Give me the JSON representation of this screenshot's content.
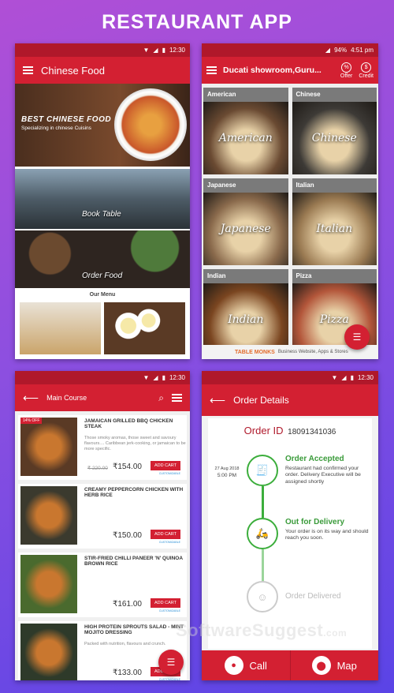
{
  "header": {
    "title": "RESTAURANT APP"
  },
  "phone1": {
    "time": "12:30",
    "title": "Chinese Food",
    "banner_title": "BEST CHINESE FOOD",
    "banner_subtitle": "Specializing in chinese Cuisins",
    "book_label": "Book Table",
    "order_label": "Order Food",
    "menu_heading": "Our Menu"
  },
  "phone2": {
    "battery": "94%",
    "time": "4:51 pm",
    "title": "Ducati showroom,Guru...",
    "offer_label": "Offer",
    "credit_label": "Credit",
    "cuisines": [
      {
        "name": "American",
        "script": "American",
        "color": "#6a4a32"
      },
      {
        "name": "Chinese",
        "script": "Chinese",
        "color": "#3d3a36"
      },
      {
        "name": "Japanese",
        "script": "Japanese",
        "color": "#8a6a4c"
      },
      {
        "name": "Italian",
        "script": "Italian",
        "color": "#9a7a52"
      },
      {
        "name": "Indian",
        "script": "Indian",
        "color": "#7a4520"
      },
      {
        "name": "Pizza",
        "script": "Pizza",
        "color": "#b3563a"
      }
    ],
    "brand": "TABLE MONKS",
    "brand_tag": "Business Website, Apps & Stores"
  },
  "phone3": {
    "time": "12:30",
    "title": "Main Course",
    "add_label": "ADD CART",
    "custom_label": "CUSTOMIZABLE",
    "dishes": [
      {
        "name": "JAMAICAN GRILLED BBQ CHICKEN STEAK",
        "desc": "Those smoky aromas, those sweet and savoury flavours.... Caribbean jerk-cooking, or jamaican to be more specific.",
        "old_price": "₹ 220.00",
        "price": "₹154.00",
        "badge": "14% OFF"
      },
      {
        "name": "CREAMY PEPPERCORN CHICKEN WITH HERB RICE",
        "desc": "",
        "old_price": "",
        "price": "₹150.00",
        "badge": ""
      },
      {
        "name": "STIR-FRIED CHILLI PANEER 'N' QUINOA BROWN RICE",
        "desc": "",
        "old_price": "",
        "price": "₹161.00",
        "badge": ""
      },
      {
        "name": "HIGH PROTEIN SPROUTS SALAD - MINT MOJITO DRESSING",
        "desc": "Packed with nutrition, flavours and crunch.",
        "old_price": "",
        "price": "₹133.00",
        "badge": ""
      }
    ]
  },
  "phone4": {
    "time": "12:30",
    "title": "Order Details",
    "order_label": "Order ID",
    "order_id": "18091341036",
    "date": "27 Aug 2018",
    "clock": "5:00 PM",
    "stages": [
      {
        "title": "Order Accepted",
        "desc": "Restaurant had confirmed your order. Delivery Executive will be assigned shortly"
      },
      {
        "title": "Out for Delivery",
        "desc": "Your order is on its way and should reach you soon."
      },
      {
        "title": "Order Delivered",
        "desc": ""
      }
    ],
    "call_label": "Call",
    "map_label": "Map"
  },
  "watermark": {
    "main": "SoftwareSuggest",
    "suffix": ".com"
  }
}
